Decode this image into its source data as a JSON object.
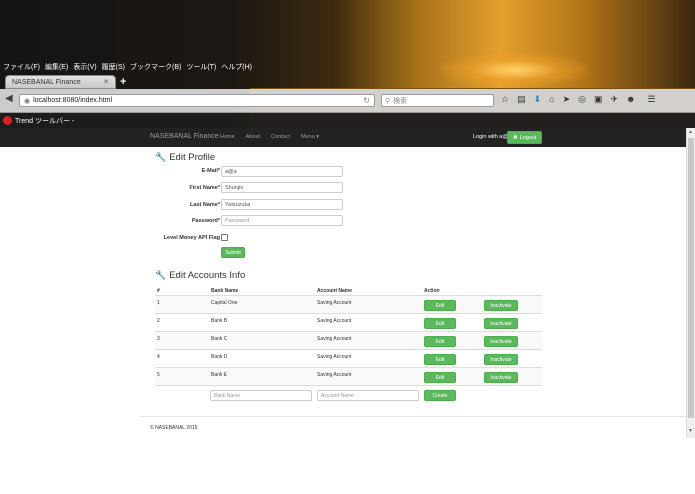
{
  "browser": {
    "menu": [
      "ファイル(F)",
      "編集(E)",
      "表示(V)",
      "履歴(S)",
      "ブックマーク(B)",
      "ツール(T)",
      "ヘルプ(H)"
    ],
    "tab_title": "NASEBANAL Finance",
    "url": "localhost:8080/index.html",
    "search_placeholder": "検索",
    "trend_toolbar": "Trend ツールバー -"
  },
  "site_nav": {
    "brand": "NASEBANAL Finance",
    "links": [
      "Home",
      "About",
      "Contact",
      "Menu ▾"
    ],
    "login_text": "Login with a@a",
    "logout_label": "Logout"
  },
  "profile": {
    "heading": "Edit Profile",
    "fields": [
      {
        "label": "E-Mail*",
        "value": "a@a",
        "placeholder": ""
      },
      {
        "label": "First Name*",
        "value": "Shunjio",
        "placeholder": ""
      },
      {
        "label": "Last Name*",
        "value": "Yatsuzuka",
        "placeholder": ""
      },
      {
        "label": "Password*",
        "value": "",
        "placeholder": "Password"
      }
    ],
    "flag_label": "Level Money API Flag",
    "submit_label": "Submit"
  },
  "accounts": {
    "heading": "Edit Accounts Info",
    "columns": [
      "#",
      "Bank Name",
      "Account Name",
      "Action"
    ],
    "rows": [
      {
        "num": "1",
        "bank": "Capital One",
        "account": "Saving Account"
      },
      {
        "num": "2",
        "bank": "Bank B",
        "account": "Saving Account"
      },
      {
        "num": "3",
        "bank": "Bank C",
        "account": "Saving Account"
      },
      {
        "num": "4",
        "bank": "Bank D",
        "account": "Saving Account"
      },
      {
        "num": "5",
        "bank": "Bank E",
        "account": "Saving Account"
      }
    ],
    "edit_label": "Edit",
    "inactivate_label": "Inactivate",
    "new_bank_placeholder": "Bank Name",
    "new_account_placeholder": "Account Name",
    "create_label": "Create"
  },
  "footer": "© NASEBANAL 2015",
  "colors": {
    "success": "#5cb85c",
    "navbar": "#222222"
  }
}
